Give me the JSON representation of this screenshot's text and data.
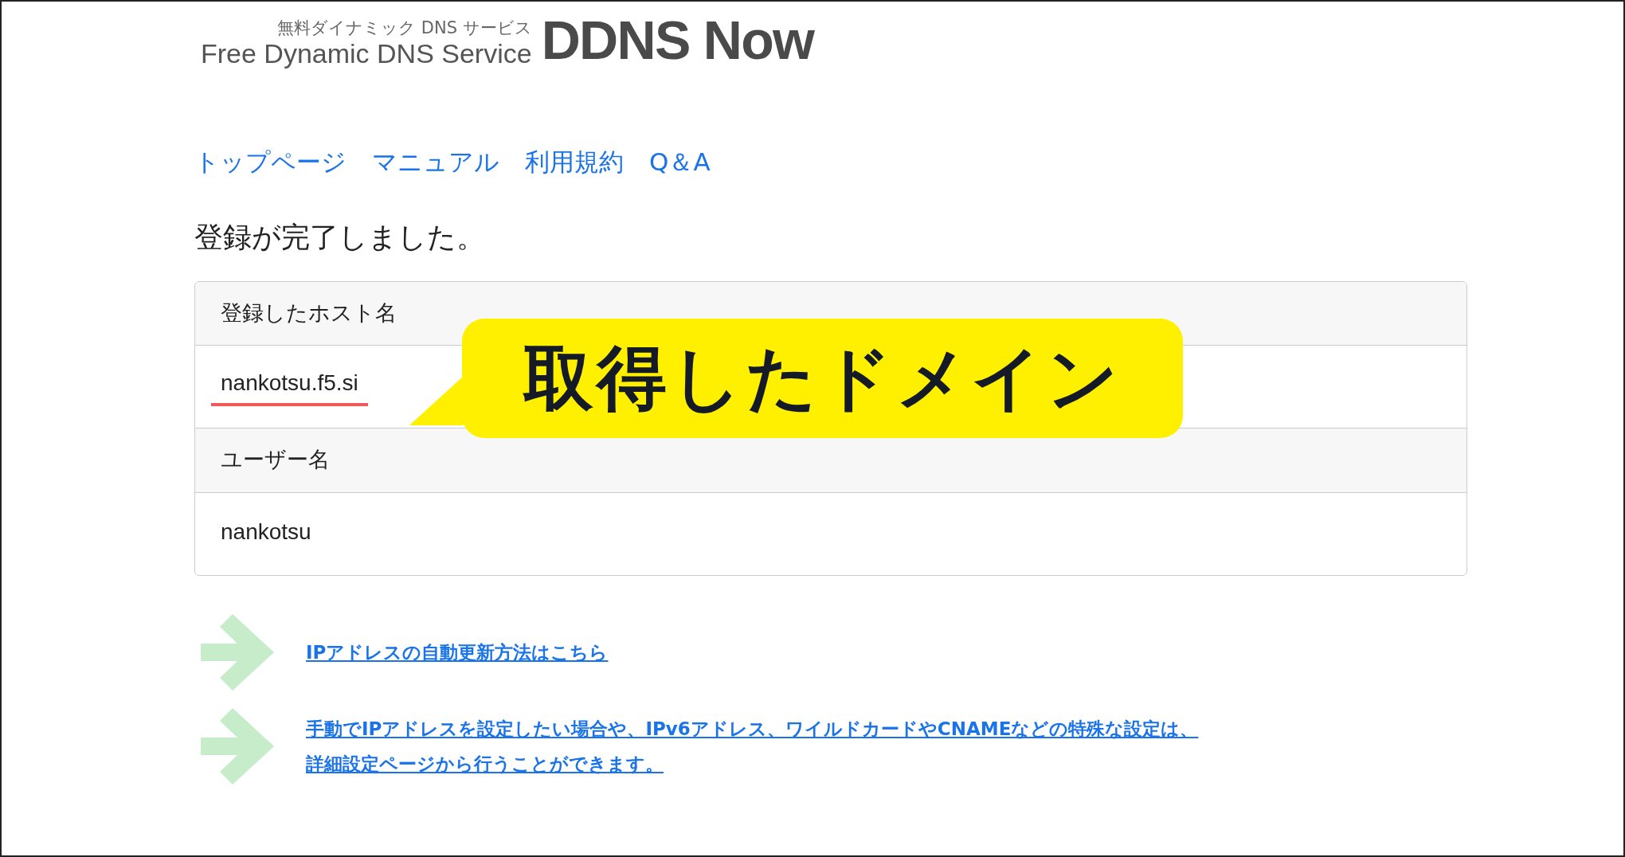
{
  "logo": {
    "tagline_ja": "無料ダイナミック DNS サービス",
    "tagline_en": "Free Dynamic DNS Service",
    "name": "DDNS Now"
  },
  "nav": [
    {
      "label": "トップページ"
    },
    {
      "label": "マニュアル"
    },
    {
      "label": "利用規約"
    },
    {
      "label": "Q＆A"
    }
  ],
  "heading": "登録が完了しました。",
  "table": [
    {
      "kind": "header",
      "text": "登録したホスト名"
    },
    {
      "kind": "value",
      "text": "nankotsu.f5.si",
      "underlined": true
    },
    {
      "kind": "header",
      "text": "ユーザー名"
    },
    {
      "kind": "value",
      "text": "nankotsu",
      "underlined": false
    }
  ],
  "callout": "取得したドメイン",
  "links": [
    {
      "lines": [
        "IPアドレスの自動更新方法はこちら"
      ]
    },
    {
      "lines": [
        "手動でIPアドレスを設定したい場合や、IPv6アドレス、ワイルドカードやCNAMEなどの特殊な設定は、",
        "詳細設定ページから行うことができます。"
      ]
    }
  ]
}
